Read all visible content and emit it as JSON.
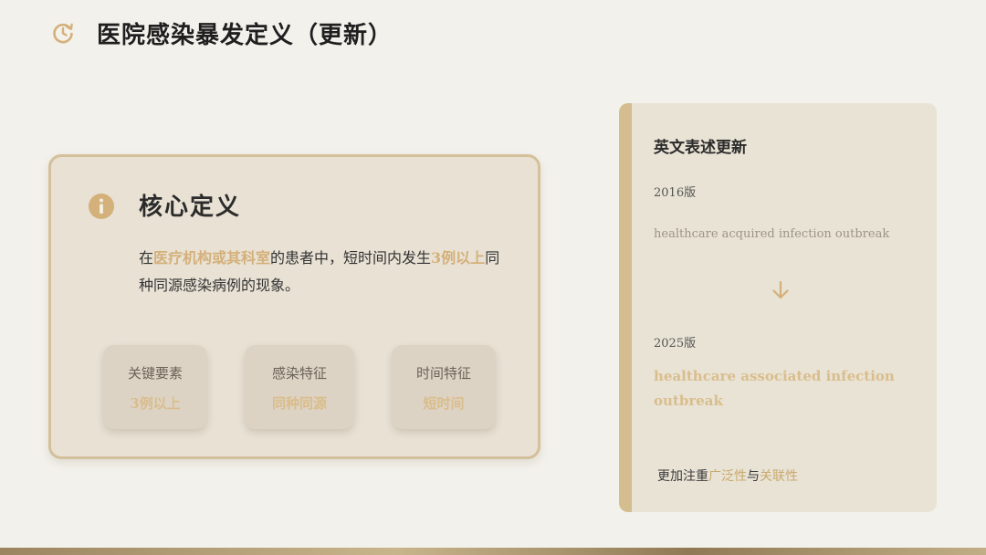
{
  "header": {
    "title": "医院感染暴发定义（更新）",
    "icon": "clock-refresh-icon",
    "accent_color": "#d4b07a"
  },
  "core": {
    "title": "核心定义",
    "icon": "info-icon",
    "desc_prefix": "在",
    "desc_hl1": "医疗机构或其科室",
    "desc_mid": "的患者中，短时间内发生",
    "desc_hl2": "3例以上",
    "desc_suffix": "同种同源感染病例的现象。",
    "elements": [
      {
        "label": "关键要素",
        "value": "3例以上"
      },
      {
        "label": "感染特征",
        "value": "同种同源"
      },
      {
        "label": "时间特征",
        "value": "短时间"
      }
    ]
  },
  "english": {
    "title": "英文表述更新",
    "old_version": "2016版",
    "old_term": "healthcare acquired infection outbreak",
    "arrow_icon": "arrow-down-icon",
    "new_version": "2025版",
    "new_term": "healthcare associated infection outbreak",
    "emphasis_prefix": "更加注重",
    "emphasis_hl1": "广泛性",
    "emphasis_mid": "与",
    "emphasis_hl2": "关联性"
  }
}
